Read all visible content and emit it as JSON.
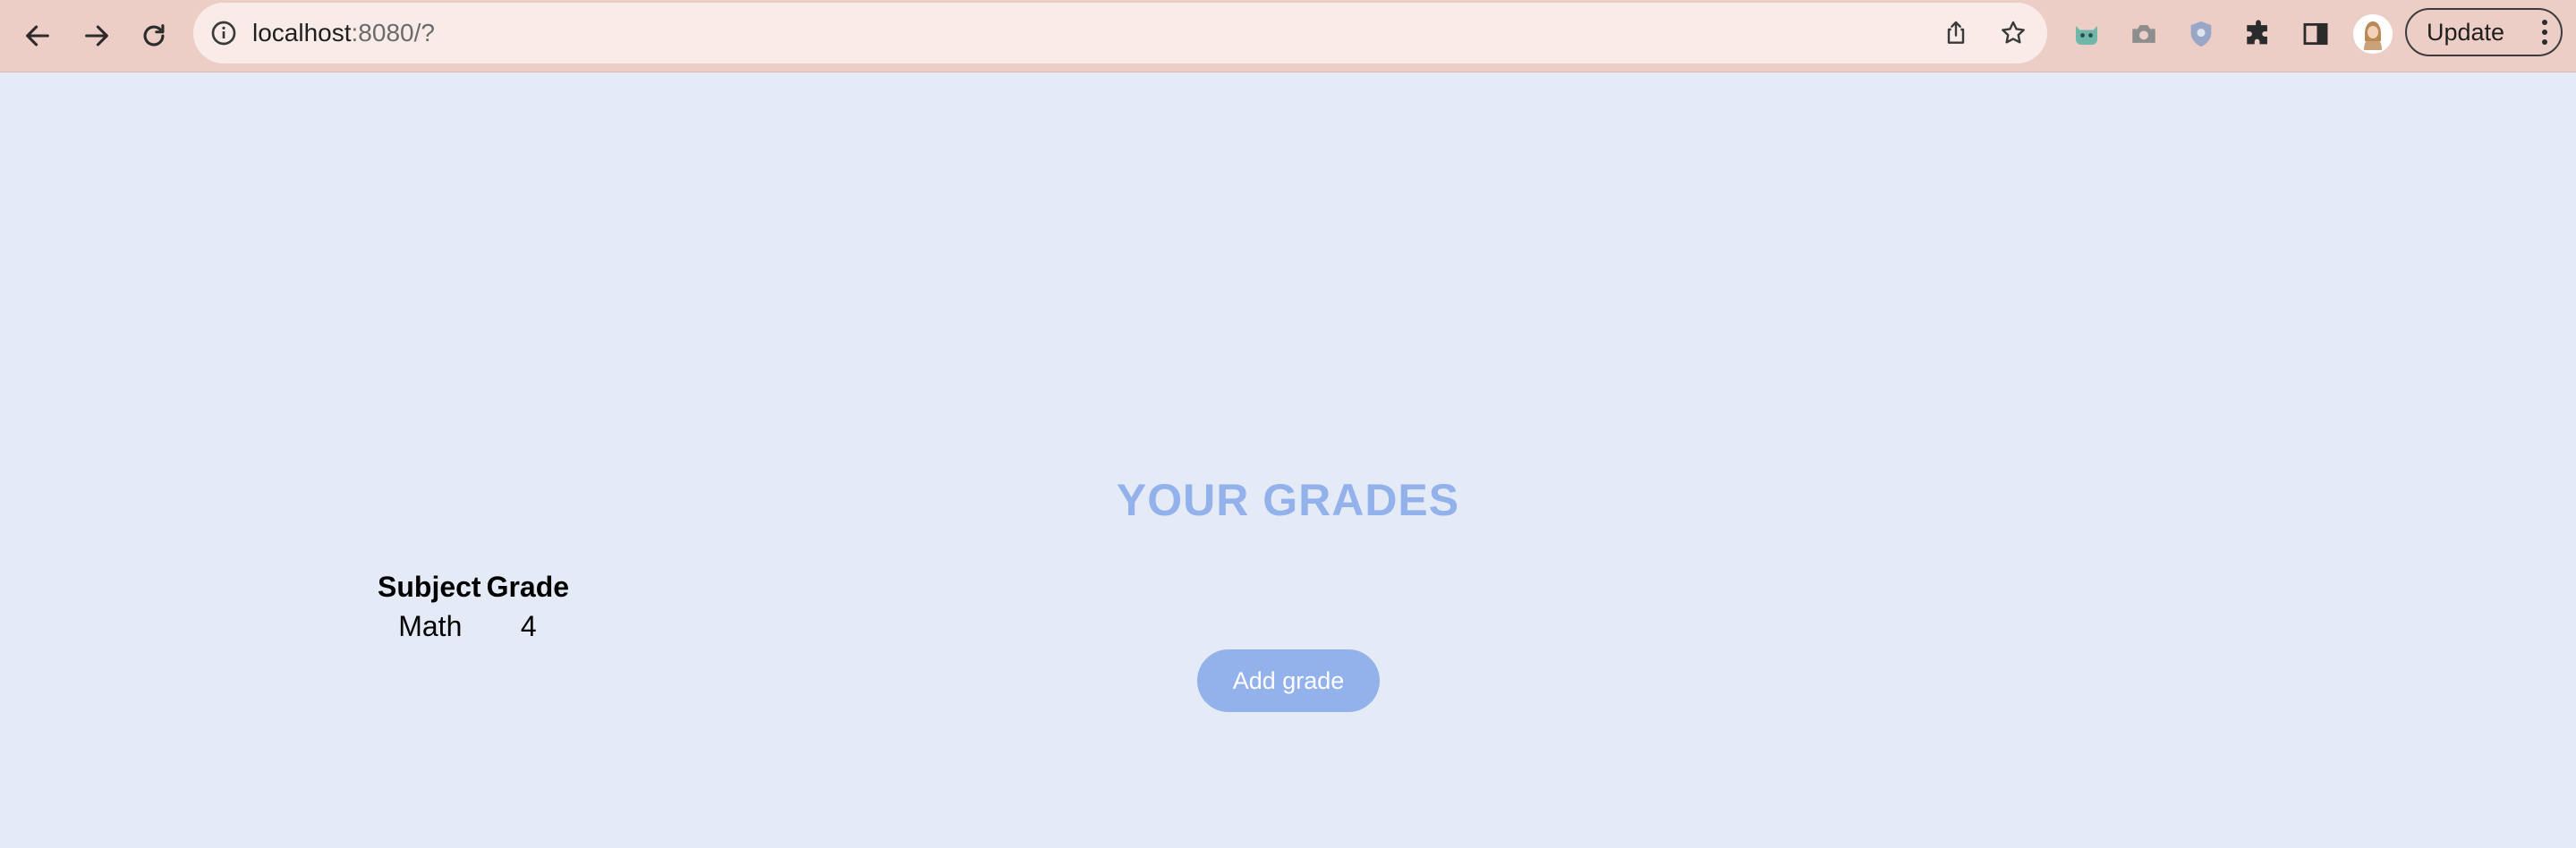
{
  "browser": {
    "url_host": "localhost",
    "url_rest": ":8080/?",
    "update_label": "Update",
    "icons": [
      "back-icon",
      "forward-icon",
      "reload-icon",
      "site-info-icon",
      "share-icon",
      "bookmark-star-icon",
      "extension-cat-icon",
      "extension-camera-icon",
      "extension-shield-icon",
      "extensions-puzzle-icon",
      "side-panel-icon",
      "profile-avatar",
      "menu-dots-icon"
    ]
  },
  "page": {
    "heading": "YOUR GRADES",
    "table": {
      "headers": [
        "Subject",
        "Grade"
      ],
      "rows": [
        [
          "Math",
          "4"
        ]
      ]
    },
    "add_button_label": "Add grade"
  },
  "colors": {
    "page_background": "#e4ebf7",
    "accent": "#93b1ea",
    "toolbar": "#edcec6"
  }
}
